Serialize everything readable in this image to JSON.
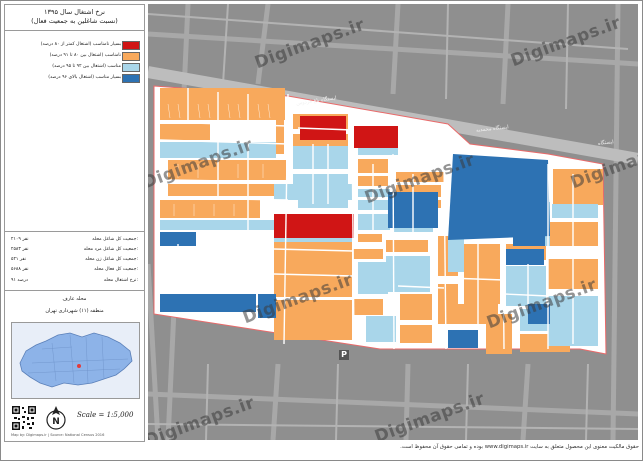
{
  "panel": {
    "title_line1": "نرخ اشتغال سال ۱۳۹۵",
    "title_line2": "(نسبت شاغلین به جمعیت فعال)",
    "legend": [
      {
        "label": "بسیار نامناسب (اشتغال کمتر از ۸۰ درصد)",
        "color": "#d01515"
      },
      {
        "label": "نامناسب (اشتغال بین ۸۰ تا ۹۱ درصد)",
        "color": "#f8a95c"
      },
      {
        "label": "مناسب (اشتغال بین ۹۲ تا ۹۵ درصد)",
        "color": "#a9d6ea"
      },
      {
        "label": "بسیار مناسب (اشتغال بالای ۹۶ درصد)",
        "color": "#2d72b3"
      }
    ],
    "stats": [
      {
        "label": "جمعیت کل شاغل محله:",
        "value": "۲۱۰۹ نفر"
      },
      {
        "label": "جمعیت کل شاغل مرد محله:",
        "value": "۲۵۸۳ نفر"
      },
      {
        "label": "جمعیت کل شاغل زن محله:",
        "value": "۵۲۱ نفر"
      },
      {
        "label": "جمعیت کل فعال محله:",
        "value": "۵۶۸۸ نفر"
      },
      {
        "label": "نرخ اشتغال محله:",
        "value": "۹۱ درصد"
      }
    ],
    "location_line1": "محله عارف",
    "location_line2": "منطقه (۱۱) شهرداری تهران",
    "scale": "Scale = 1:5,000",
    "small_credit": "Map by: Digimaps.ir | Source: National Census 2016",
    "qr_icon": "qr-code-icon",
    "north_icon": "north-arrow-icon"
  },
  "map": {
    "watermark": "Digimaps.ir",
    "street_labels": [
      "ایستگاه باغ فردوس",
      "ایستگاه محمدیه",
      "ایستگاه"
    ],
    "parking": "P"
  },
  "footer": "حقوق مالکیت معنوی این محصول متعلق به سایت www.digimaps.ir بوده و تمامی حقوق آن محفوظ است."
}
